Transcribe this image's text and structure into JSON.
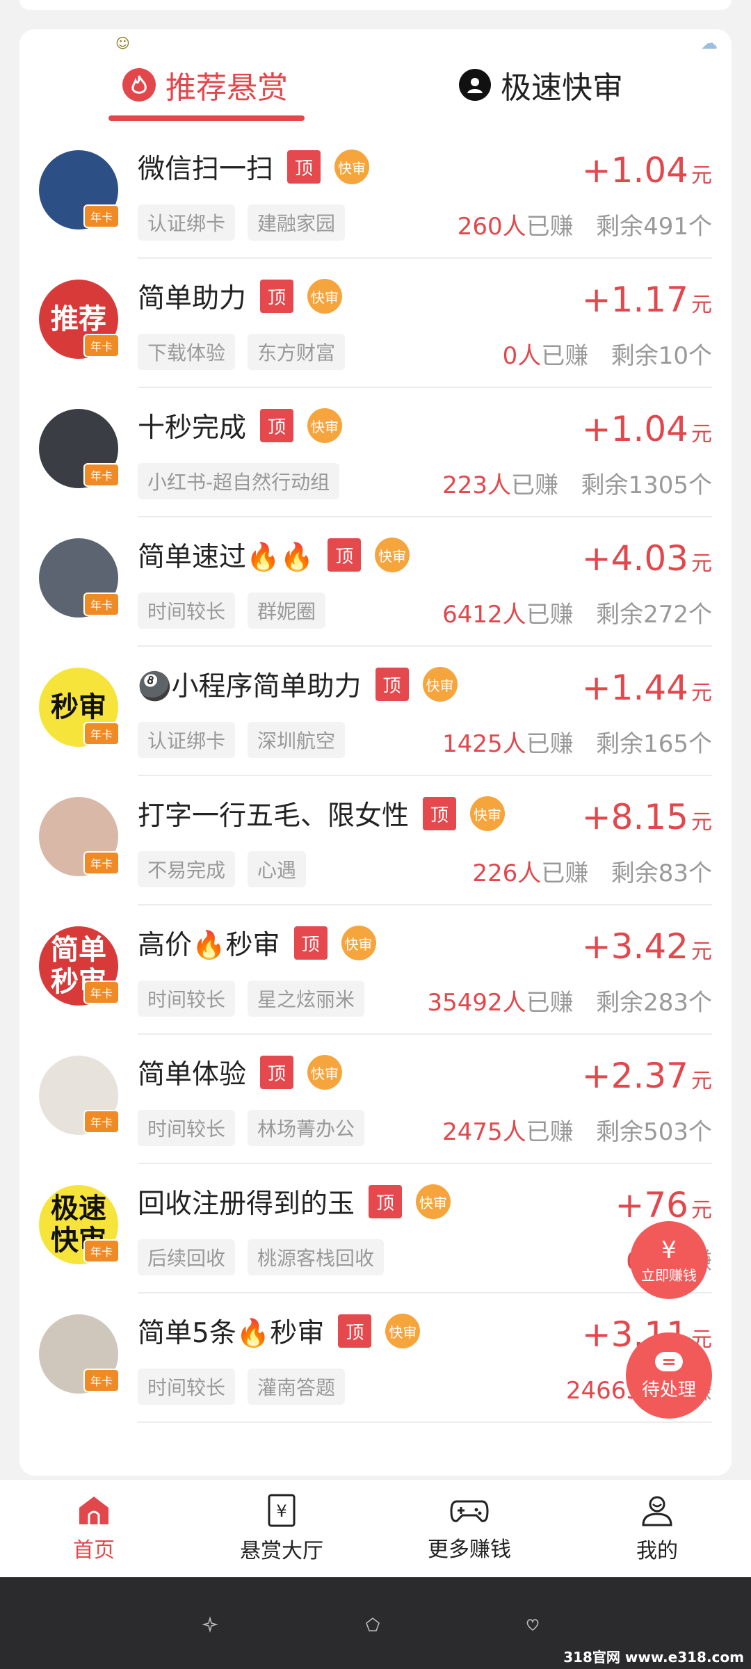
{
  "tabs": [
    {
      "label": "推荐悬赏",
      "active": true
    },
    {
      "label": "极速快审",
      "active": false
    }
  ],
  "badges": {
    "ding": "顶",
    "kuai": "快审",
    "nianka": "年卡"
  },
  "stats_labels": {
    "earned": "人",
    "earned_suffix": "已赚",
    "remain_prefix": "剩余",
    "remain_suffix": "个",
    "unit": "元"
  },
  "tasks": [
    {
      "title": "微信扫一扫",
      "tags": [
        "认证绑卡",
        "建融家园"
      ],
      "price": "+1.04",
      "earned": "260",
      "remain": "491",
      "avatar_text": "",
      "avatar_color": "#2c4f86"
    },
    {
      "title": "简单助力",
      "tags": [
        "下载体验",
        "东方财富"
      ],
      "price": "+1.17",
      "earned": "0",
      "remain": "10",
      "avatar_text": "推荐",
      "avatar_color": "#d83a3a"
    },
    {
      "title": "十秒完成",
      "tags": [
        "小红书-超自然行动组"
      ],
      "price": "+1.04",
      "earned": "223",
      "remain": "1305",
      "avatar_text": "",
      "avatar_color": "#3a3d44"
    },
    {
      "title": "简单速过🔥🔥",
      "tags": [
        "时间较长",
        "群妮圈"
      ],
      "price": "+4.03",
      "earned": "6412",
      "remain": "272",
      "avatar_text": "",
      "avatar_color": "#5b6470"
    },
    {
      "title": "🎱小程序简单助力",
      "tags": [
        "认证绑卡",
        "深圳航空"
      ],
      "price": "+1.44",
      "earned": "1425",
      "remain": "165",
      "avatar_text": "秒审",
      "avatar_color": "#f7e43a"
    },
    {
      "title": "打字一行五毛、限女性",
      "tags": [
        "不易完成",
        "心遇"
      ],
      "price": "+8.15",
      "earned": "226",
      "remain": "83",
      "avatar_text": "",
      "avatar_color": "#d9b8a8"
    },
    {
      "title": "高价🔥秒审",
      "tags": [
        "时间较长",
        "星之炫丽米"
      ],
      "price": "+3.42",
      "earned": "35492",
      "remain": "283",
      "avatar_text": "简单秒审",
      "avatar_color": "#d83a3a"
    },
    {
      "title": "简单体验",
      "tags": [
        "时间较长",
        "林场菁办公"
      ],
      "price": "+2.37",
      "earned": "2475",
      "remain": "503",
      "avatar_text": "",
      "avatar_color": "#e8e2dc"
    },
    {
      "title": "回收注册得到的玉",
      "tags": [
        "后续回收",
        "桃源客栈回收"
      ],
      "price": "+76",
      "earned": "0",
      "remain": "",
      "avatar_text": "极速快审",
      "avatar_color": "#f7e43a"
    },
    {
      "title": "简单5条🔥秒审",
      "tags": [
        "时间较长",
        "灌南答题"
      ],
      "price": "+3.11",
      "earned": "24663",
      "remain": "",
      "avatar_text": "",
      "avatar_color": "#cfc7bc"
    }
  ],
  "fab": {
    "earn_label": "立即赚钱",
    "earn_icon": "¥",
    "pending_label": "待处理"
  },
  "nav": [
    {
      "label": "首页",
      "icon": "home-icon",
      "active": true
    },
    {
      "label": "悬赏大厅",
      "icon": "yuan-doc-icon",
      "active": false
    },
    {
      "label": "更多赚钱",
      "icon": "gamepad-icon",
      "active": false
    },
    {
      "label": "我的",
      "icon": "user-icon",
      "active": false
    }
  ],
  "watermark": "318官网 www.e318.com",
  "colors": {
    "accent": "#e2474c",
    "nianka": "#f08a24",
    "kuai": "#f5a53c"
  }
}
